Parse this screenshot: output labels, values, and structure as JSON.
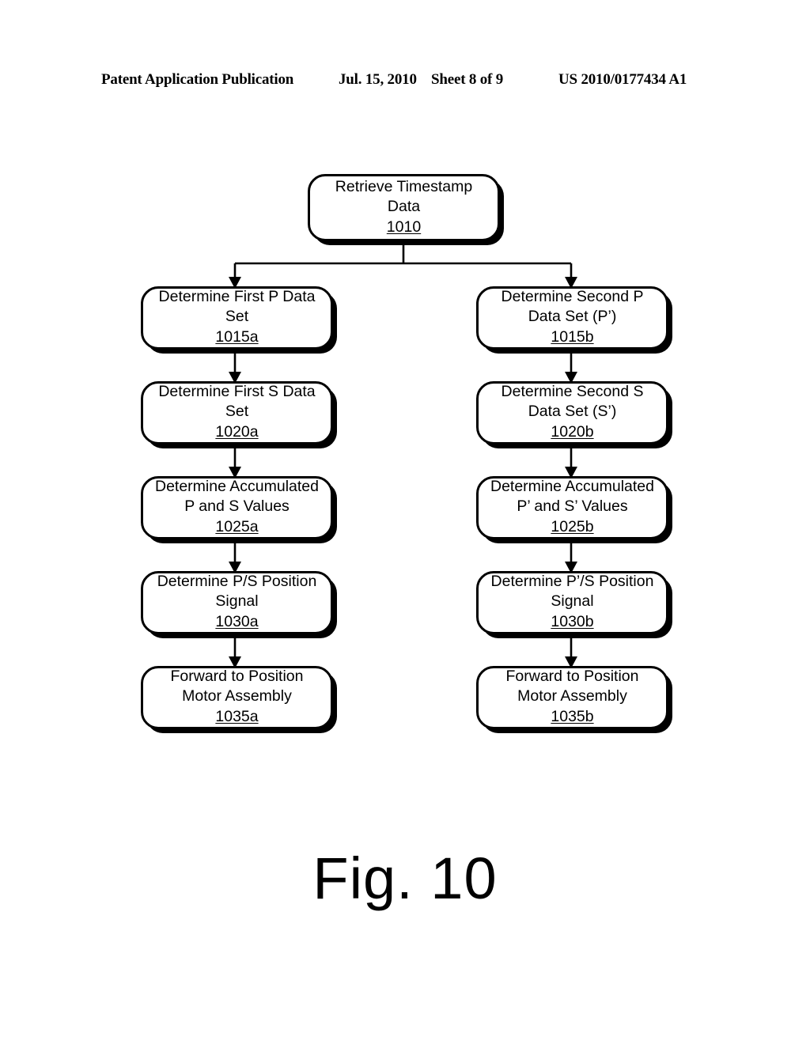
{
  "header": {
    "publication": "Patent Application Publication",
    "date": "Jul. 15, 2010",
    "sheet": "Sheet 8 of 9",
    "patent_number": "US 2010/0177434 A1"
  },
  "figure": {
    "caption": "Fig. 10",
    "colors": {
      "stroke": "#000000",
      "fill": "#ffffff",
      "shadow": "#000000"
    },
    "nodes": {
      "start": {
        "text": "Retrieve Timestamp\nData",
        "ref": "1010"
      },
      "left": [
        {
          "text": "Determine First P Data\nSet",
          "ref": "1015a"
        },
        {
          "text": "Determine First S Data\nSet",
          "ref": "1020a"
        },
        {
          "text": "Determine Accumulated\nP and S Values",
          "ref": "1025a"
        },
        {
          "text": "Determine P/S Position\nSignal",
          "ref": "1030a"
        },
        {
          "text": "Forward to Position\nMotor Assembly",
          "ref": "1035a"
        }
      ],
      "right": [
        {
          "text": "Determine Second P\nData Set (P’)",
          "ref": "1015b"
        },
        {
          "text": "Determine Second S\nData Set (S’)",
          "ref": "1020b"
        },
        {
          "text": "Determine Accumulated\nP’ and S’ Values",
          "ref": "1025b"
        },
        {
          "text": "Determine P’/S Position\nSignal",
          "ref": "1030b"
        },
        {
          "text": "Forward to Position\nMotor Assembly",
          "ref": "1035b"
        }
      ]
    }
  }
}
